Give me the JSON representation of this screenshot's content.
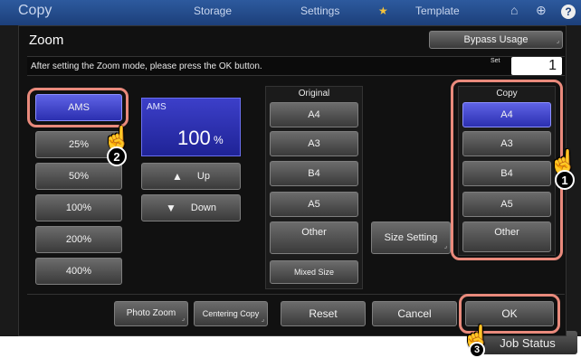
{
  "background": {
    "tabs": [
      "Copy",
      "Storage",
      "Settings",
      "Template"
    ],
    "job_status": "Job Status"
  },
  "dialog": {
    "title": "Zoom",
    "bypass_button": "Bypass Usage",
    "message": "After setting the Zoom mode, please press the OK button.",
    "set_label": "Set",
    "set_value": "1"
  },
  "zoom_presets": [
    "AMS",
    "25%",
    "50%",
    "100%",
    "200%",
    "400%"
  ],
  "ams_display": {
    "label": "AMS",
    "value": "100",
    "unit": "%"
  },
  "adjust": {
    "up": "Up",
    "down": "Down"
  },
  "original": {
    "title": "Original",
    "sizes": [
      "A4",
      "A3",
      "B4",
      "A5",
      "Other"
    ],
    "mixed": "Mixed Size"
  },
  "size_setting": "Size Setting",
  "copy": {
    "title": "Copy",
    "sizes": [
      "A4",
      "A3",
      "B4",
      "A5",
      "Other"
    ],
    "selected": "A4"
  },
  "footer": {
    "photo_zoom": "Photo Zoom",
    "centering_copy": "Centering Copy",
    "reset": "Reset",
    "cancel": "Cancel",
    "ok": "OK"
  },
  "callouts": [
    "1",
    "2",
    "3"
  ],
  "colors": {
    "selected": "#3b3fd0",
    "highlight": "#e98a7c",
    "dialog_bg": "#111111"
  }
}
